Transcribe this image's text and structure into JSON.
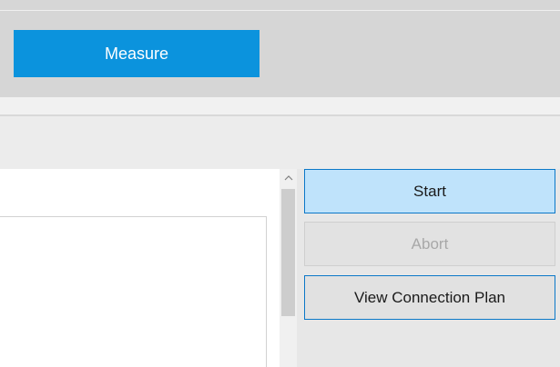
{
  "tabs": {
    "measure_label": "Measure"
  },
  "actions": {
    "start_label": "Start",
    "abort_label": "Abort",
    "view_connection_plan_label": "View Connection Plan"
  },
  "icons": {
    "scroll_up": "chevron-up-icon"
  },
  "colors": {
    "accent": "#0b93dd",
    "start_bg": "#bfe3fb",
    "focus_border": "#0b78c8"
  }
}
